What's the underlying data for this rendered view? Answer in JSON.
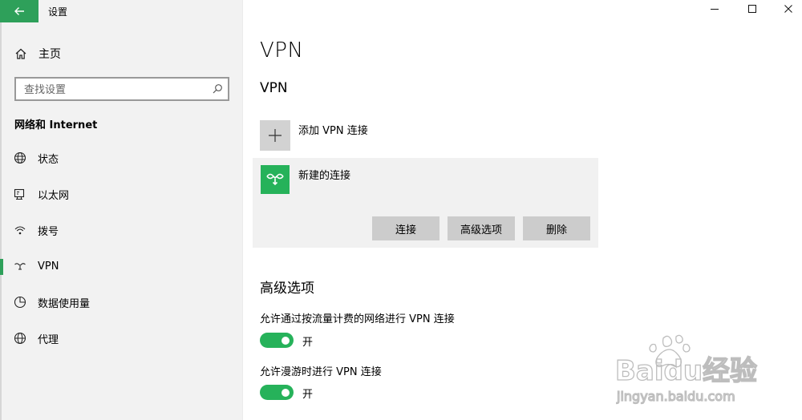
{
  "window": {
    "title": "设置",
    "controls": {
      "minimize": "minimize-icon",
      "maximize": "maximize-icon",
      "close": "close-icon"
    }
  },
  "sidebar": {
    "home": "主页",
    "search_placeholder": "查找设置",
    "section": "网络和 Internet",
    "items": [
      {
        "label": "状态",
        "icon": "globe-status-icon"
      },
      {
        "label": "以太网",
        "icon": "ethernet-icon"
      },
      {
        "label": "拨号",
        "icon": "dialup-icon"
      },
      {
        "label": "VPN",
        "icon": "vpn-icon",
        "selected": true
      },
      {
        "label": "数据使用量",
        "icon": "data-usage-icon"
      },
      {
        "label": "代理",
        "icon": "globe-proxy-icon"
      }
    ]
  },
  "main": {
    "title": "VPN",
    "subtitle": "VPN",
    "add_label": "添加 VPN 连接",
    "connection": {
      "name": "新建的连接",
      "buttons": {
        "connect": "连接",
        "advanced": "高级选项",
        "delete": "删除"
      }
    },
    "advanced_heading": "高级选项",
    "options": [
      {
        "label": "允许通过按流量计费的网络进行 VPN 连接",
        "state": "开",
        "on": true
      },
      {
        "label": "允许漫游时进行 VPN 连接",
        "state": "开",
        "on": true
      }
    ]
  },
  "colors": {
    "accent": "#26b25a",
    "back_button": "#2ea05a",
    "card": "#f1f1f1",
    "button": "#cccccc"
  },
  "watermark": {
    "brand": "Baidu经验",
    "url": "jingyan.baidu.com"
  }
}
